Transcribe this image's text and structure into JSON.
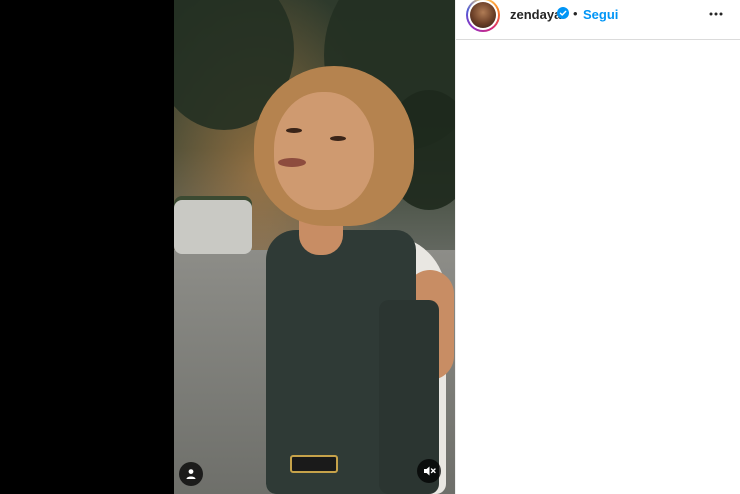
{
  "post": {
    "username": "zendaya",
    "verified": true,
    "follow_label": "Segui",
    "separator": "•"
  },
  "media": {
    "type": "video",
    "muted": true
  },
  "icons": {
    "avatar": "profile-photo",
    "verified": "verified-badge-icon",
    "more": "more-options-icon",
    "tagged_user": "user-tag-icon",
    "mute": "muted-speaker-icon"
  },
  "colors": {
    "accent": "#0095f6",
    "text": "#262626",
    "divider": "#dbdbdb",
    "left_background": "#000000"
  }
}
